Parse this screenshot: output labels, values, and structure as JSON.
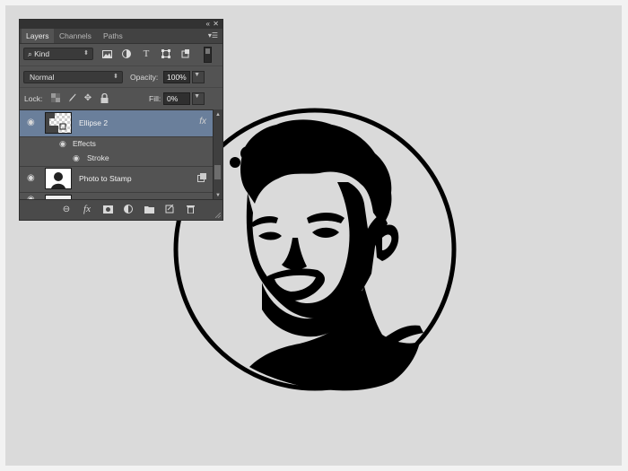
{
  "panel": {
    "collapse_glyph": "«",
    "close_glyph": "✕",
    "menu_glyph": "▾☰",
    "tabs": [
      {
        "label": "Layers",
        "active": true
      },
      {
        "label": "Channels",
        "active": false
      },
      {
        "label": "Paths",
        "active": false
      }
    ],
    "filter": {
      "kind_label": "Kind",
      "icons": [
        "image-filter-icon",
        "adjustment-filter-icon",
        "type-filter-icon",
        "shape-filter-icon",
        "smart-object-filter-icon"
      ]
    },
    "blend_mode": "Normal",
    "opacity_label": "Opacity:",
    "opacity_value": "100%",
    "lock_label": "Lock:",
    "lock_icons": [
      "lock-transparent-pixels-icon",
      "lock-image-pixels-icon",
      "lock-position-icon",
      "lock-all-icon"
    ],
    "fill_label": "Fill:",
    "fill_value": "0%",
    "layers": [
      {
        "name": "Ellipse 2",
        "selected": true,
        "has_fx": true,
        "fx_label": "fx",
        "effects_label": "Effects",
        "effect_items": [
          "Stroke"
        ]
      },
      {
        "name": "Photo to Stamp",
        "selected": false,
        "has_fx": false
      }
    ],
    "bottom_icons": [
      "link-layers-icon",
      "layer-style-icon",
      "add-mask-icon",
      "adjustment-layer-icon",
      "new-group-icon",
      "new-layer-icon",
      "delete-layer-icon"
    ],
    "colors": {
      "panel_bg": "#535353",
      "selected_row": "#6a7f9b",
      "canvas_bg": "#dadada"
    }
  },
  "canvas": {
    "content": "stamp-portrait",
    "ring_color": "#000000"
  }
}
